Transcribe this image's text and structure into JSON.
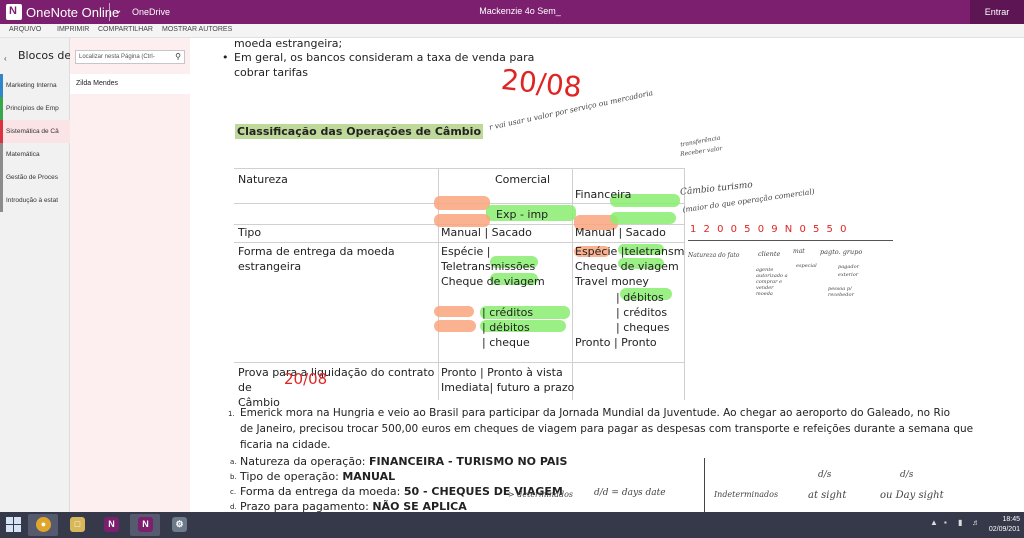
{
  "app": {
    "name": "OneNote Online",
    "logo_letter": "N",
    "onedrive": "OneDrive",
    "doc_title": "Mackenzie 4o Sem_",
    "signin": "Entrar"
  },
  "menu": [
    "ARQUIVO",
    "IMPRIMIR",
    "COMPARTILHAR",
    "MOSTRAR AUTORES"
  ],
  "notebooks": {
    "header": "Blocos de Anotações",
    "sections": [
      {
        "label": "Marketing Interna",
        "color": "#2f86c9"
      },
      {
        "label": "Princípios de Emp",
        "color": "#3aa64a"
      },
      {
        "label": "Sistemática de Câ",
        "color": "#d9333f"
      },
      {
        "label": "Matemática",
        "color": "#8c8c8c"
      },
      {
        "label": "Gestão de Proces",
        "color": "#8c8c8c"
      },
      {
        "label": "Introdução à estat",
        "color": "#8c8c8c"
      }
    ]
  },
  "pages": {
    "search_placeholder": "Localizar nesta Página (Ctrl-",
    "items": [
      "Zilda Mendes"
    ]
  },
  "note": {
    "line1": "moeda estrangeira;",
    "bullet_line1": "Em geral, os bancos consideram a taxa de venda para",
    "bullet_line2": "cobrar tarifas",
    "date_hw": "20/08",
    "heading": "Classificação das Operações de Câmbio",
    "table": {
      "h_natureza": "Natureza",
      "h_comercial": "Comercial",
      "h_financeira": "Financeira",
      "exp_imp": "Exp - imp",
      "tipo": "Tipo",
      "tipo_com": "Manual | Sacado",
      "tipo_fin": "Manual | Sacado",
      "forma_l1": "Forma de entrega da moeda",
      "forma_l2": "estrangeira",
      "com_forma": [
        "Espécie |",
        "Teletransmissões",
        "Cheque de viagem",
        "",
        "| créditos",
        "| débitos",
        "| cheque"
      ],
      "fin_forma": [
        "Espécie |teletransm",
        "Cheque de viagem",
        "Travel money",
        "| débitos",
        "| créditos",
        "| cheques",
        "Pronto  | Pronto"
      ],
      "prova_l1": "Prova para a liquidação do contrato",
      "prova_l2": "de",
      "prova_l3": "Câmbio",
      "prova_com_l1": "Pronto   | Pronto à vista",
      "prova_com_l2": "Imediata| futuro a prazo",
      "prova_hw": "20/08"
    },
    "exercise": {
      "num1": "1.",
      "p1": "Emerick mora na Hungria e veio ao Brasil para participar da Jornada Mundial da Juventude. Ao chegar ao aeroporto do Galeado, no Rio",
      "p2": "de Janeiro, precisou trocar 500,00 euros em cheques de viagem para pagar as despesas com transporte e refeições durante a semana que",
      "p3": "ficaria na cidade.",
      "a_label": "a.",
      "a_text": "Natureza da operação: ",
      "a_value": "FINANCEIRA - TURISMO NO PAIS",
      "b_label": "b.",
      "b_text": "Tipo de operação: ",
      "b_value": "MANUAL",
      "c_label": "c.",
      "c_text": "Forma da entrega da moeda: ",
      "c_value": "50 - CHEQUES DE VIAGEM",
      "d_label": "d.",
      "d_text": "Prazo para pagamento: ",
      "d_value": "NÃO SE APLICA"
    },
    "handwriting": {
      "top_right_1": "r    vai usar u  valor por serviço ou mercadoria",
      "top_right_2": "transferência",
      "top_right_3": "Receber valor",
      "cambio_1": "Câmbio turismo",
      "cambio_2": "(maior do que operação comercial)",
      "code": "1 2 0 0 5 0 9 N 0 5 5 0",
      "code_l1": "Natureza   do fato",
      "code_l2": "cliente",
      "code_l3": "mat",
      "code_l4": "pagto.   grupo",
      "code_n1": "agente  autorizado  a comprar  e vender  moeda",
      "code_n2": "especial",
      "code_n3": "pagador",
      "code_n4": "exterior",
      "code_n5": "pessoa p/  recebedor",
      "bottom_1": "> determinados",
      "bottom_2": "d/d = days date",
      "bottom_3": "Indeterminados",
      "bottom_4": "d/s",
      "bottom_5": "at sight",
      "bottom_6": "d/s",
      "bottom_7": "ou Day sight"
    }
  },
  "taskbar": {
    "time": "18:45",
    "date": "02/09/201"
  }
}
